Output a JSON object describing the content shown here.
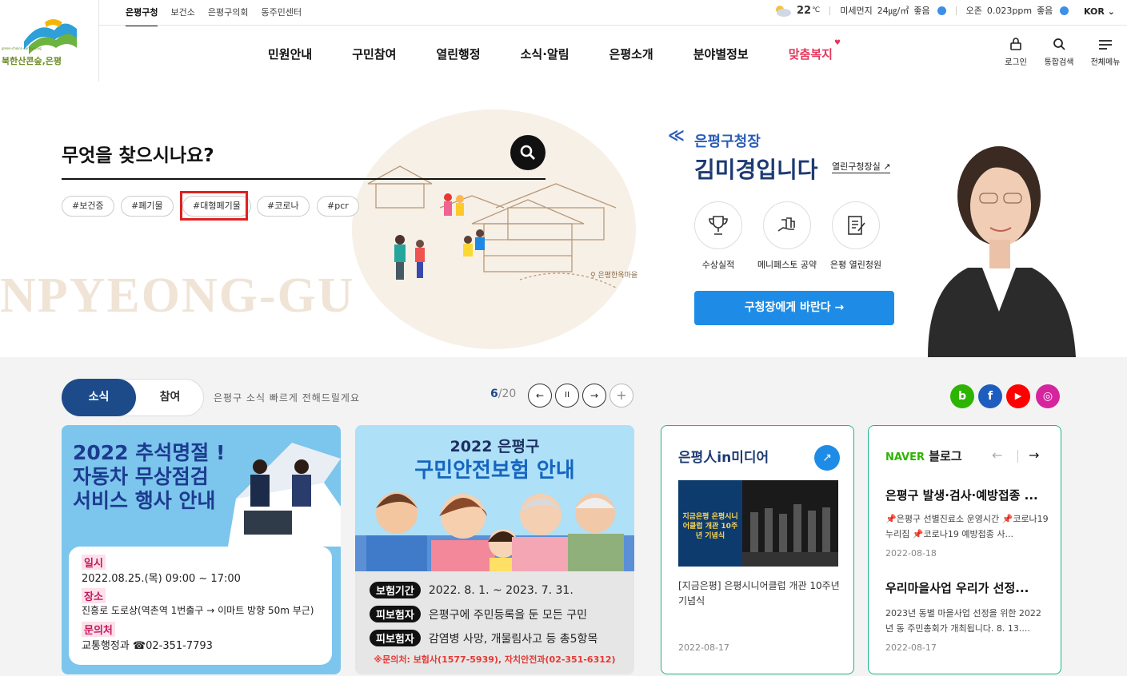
{
  "header": {
    "logo_text": "북한산콘숲,은평",
    "logo_sub": "green-choice eunpyeong",
    "top_links": [
      "은평구청",
      "보건소",
      "은평구의회",
      "동주민센터"
    ],
    "weather": {
      "temp": "22",
      "temp_unit": "℃",
      "dust_label": "미세먼지",
      "dust_value": "24㎍/㎥",
      "dust_status": "좋음",
      "ozone_label": "오존",
      "ozone_value": "0.023ppm",
      "ozone_status": "좋음"
    },
    "language": "KOR",
    "gnb": [
      "민원안내",
      "구민참여",
      "열린행정",
      "소식·알림",
      "은평소개",
      "분야별정보",
      "맞춤복지"
    ],
    "utils": [
      {
        "label": "로그인",
        "icon": "lock-icon"
      },
      {
        "label": "통합검색",
        "icon": "search-icon"
      },
      {
        "label": "전체메뉴",
        "icon": "menu-icon"
      }
    ]
  },
  "hero": {
    "search_title": "무엇을 찾으시나요?",
    "tags": [
      "#보건증",
      "#폐기물",
      "#대형폐기물",
      "#코로나",
      "#pcr"
    ],
    "watermark": "NPYEONG-GU",
    "village_label": "은평한옥마을"
  },
  "mayor": {
    "label": "은평구청장",
    "name": "김미경입니다",
    "room_link": "열린구청장실",
    "icons": [
      {
        "label": "수상실적",
        "icon": "trophy-icon"
      },
      {
        "label": "메니페스토 공약",
        "icon": "hand-icon"
      },
      {
        "label": "은평 열린청원",
        "icon": "petition-icon"
      }
    ],
    "button": "구청장에게 바란다 →"
  },
  "news": {
    "tabs": [
      "소식",
      "참여"
    ],
    "desc": "은평구 소식 빠르게 전해드릴게요",
    "page_current": "6",
    "page_total": "/20",
    "controls": [
      "←",
      "II",
      "→",
      "+"
    ],
    "sns": [
      {
        "name": "blog",
        "label": "b",
        "color": "#2db400"
      },
      {
        "name": "facebook",
        "label": "f",
        "color": "#1877f2"
      },
      {
        "name": "youtube",
        "label": "▶",
        "color": "#ff0000"
      },
      {
        "name": "instagram",
        "label": "◎",
        "color": "#d6249f"
      }
    ]
  },
  "card1": {
    "title": "2022 추석명절 ! 자동차 무상점검 서비스 행사 안내",
    "rows": [
      {
        "key": "일시",
        "value": "2022.08.25.(목) 09:00 ~ 17:00"
      },
      {
        "key": "장소",
        "value": "진흥로 도로상(역촌역 1번출구 → 이마트 방향 50m 부근)"
      },
      {
        "key": "문의처",
        "value": "교통행정과 ☎02-351-7793"
      }
    ]
  },
  "card2": {
    "subtitle": "2022 은평구",
    "title": "구민안전보험 안내",
    "rows": [
      {
        "key": "보험기간",
        "value": "2022. 8. 1. ~ 2023. 7. 31."
      },
      {
        "key": "피보험자",
        "value": "은평구에 주민등록을 둔 모든 구민"
      },
      {
        "key": "피보험자",
        "value": "감염병 사망, 개물림사고 등 총5항목"
      }
    ],
    "contact": "※문의처: 보험사(1577-5939), 자치안전과(02-351-6312)"
  },
  "media": {
    "title": "은평人in미디어",
    "img_text": "지금은평 은평시니어클럽 개관 10주년 기념식",
    "caption": "[지금은평] 은평시니어클럽 개관 10주년 기념식",
    "date": "2022-08-17"
  },
  "blog": {
    "naver": "NAVER",
    "title": "블로그",
    "posts": [
      {
        "title": "은평구 발생·검사·예방접종 ...",
        "desc": "📌은평구 선별진료소 운영시간 📌코로나19 누리집 📌코로나19 예방접종 사...",
        "date": "2022-08-18"
      },
      {
        "title": "우리마을사업 우리가 선정...",
        "desc": "2023년 동별 마을사업 선정을 위한 2022년 동 주민총회가 개최됩니다. 8. 13....",
        "date": "2022-08-17"
      }
    ]
  }
}
